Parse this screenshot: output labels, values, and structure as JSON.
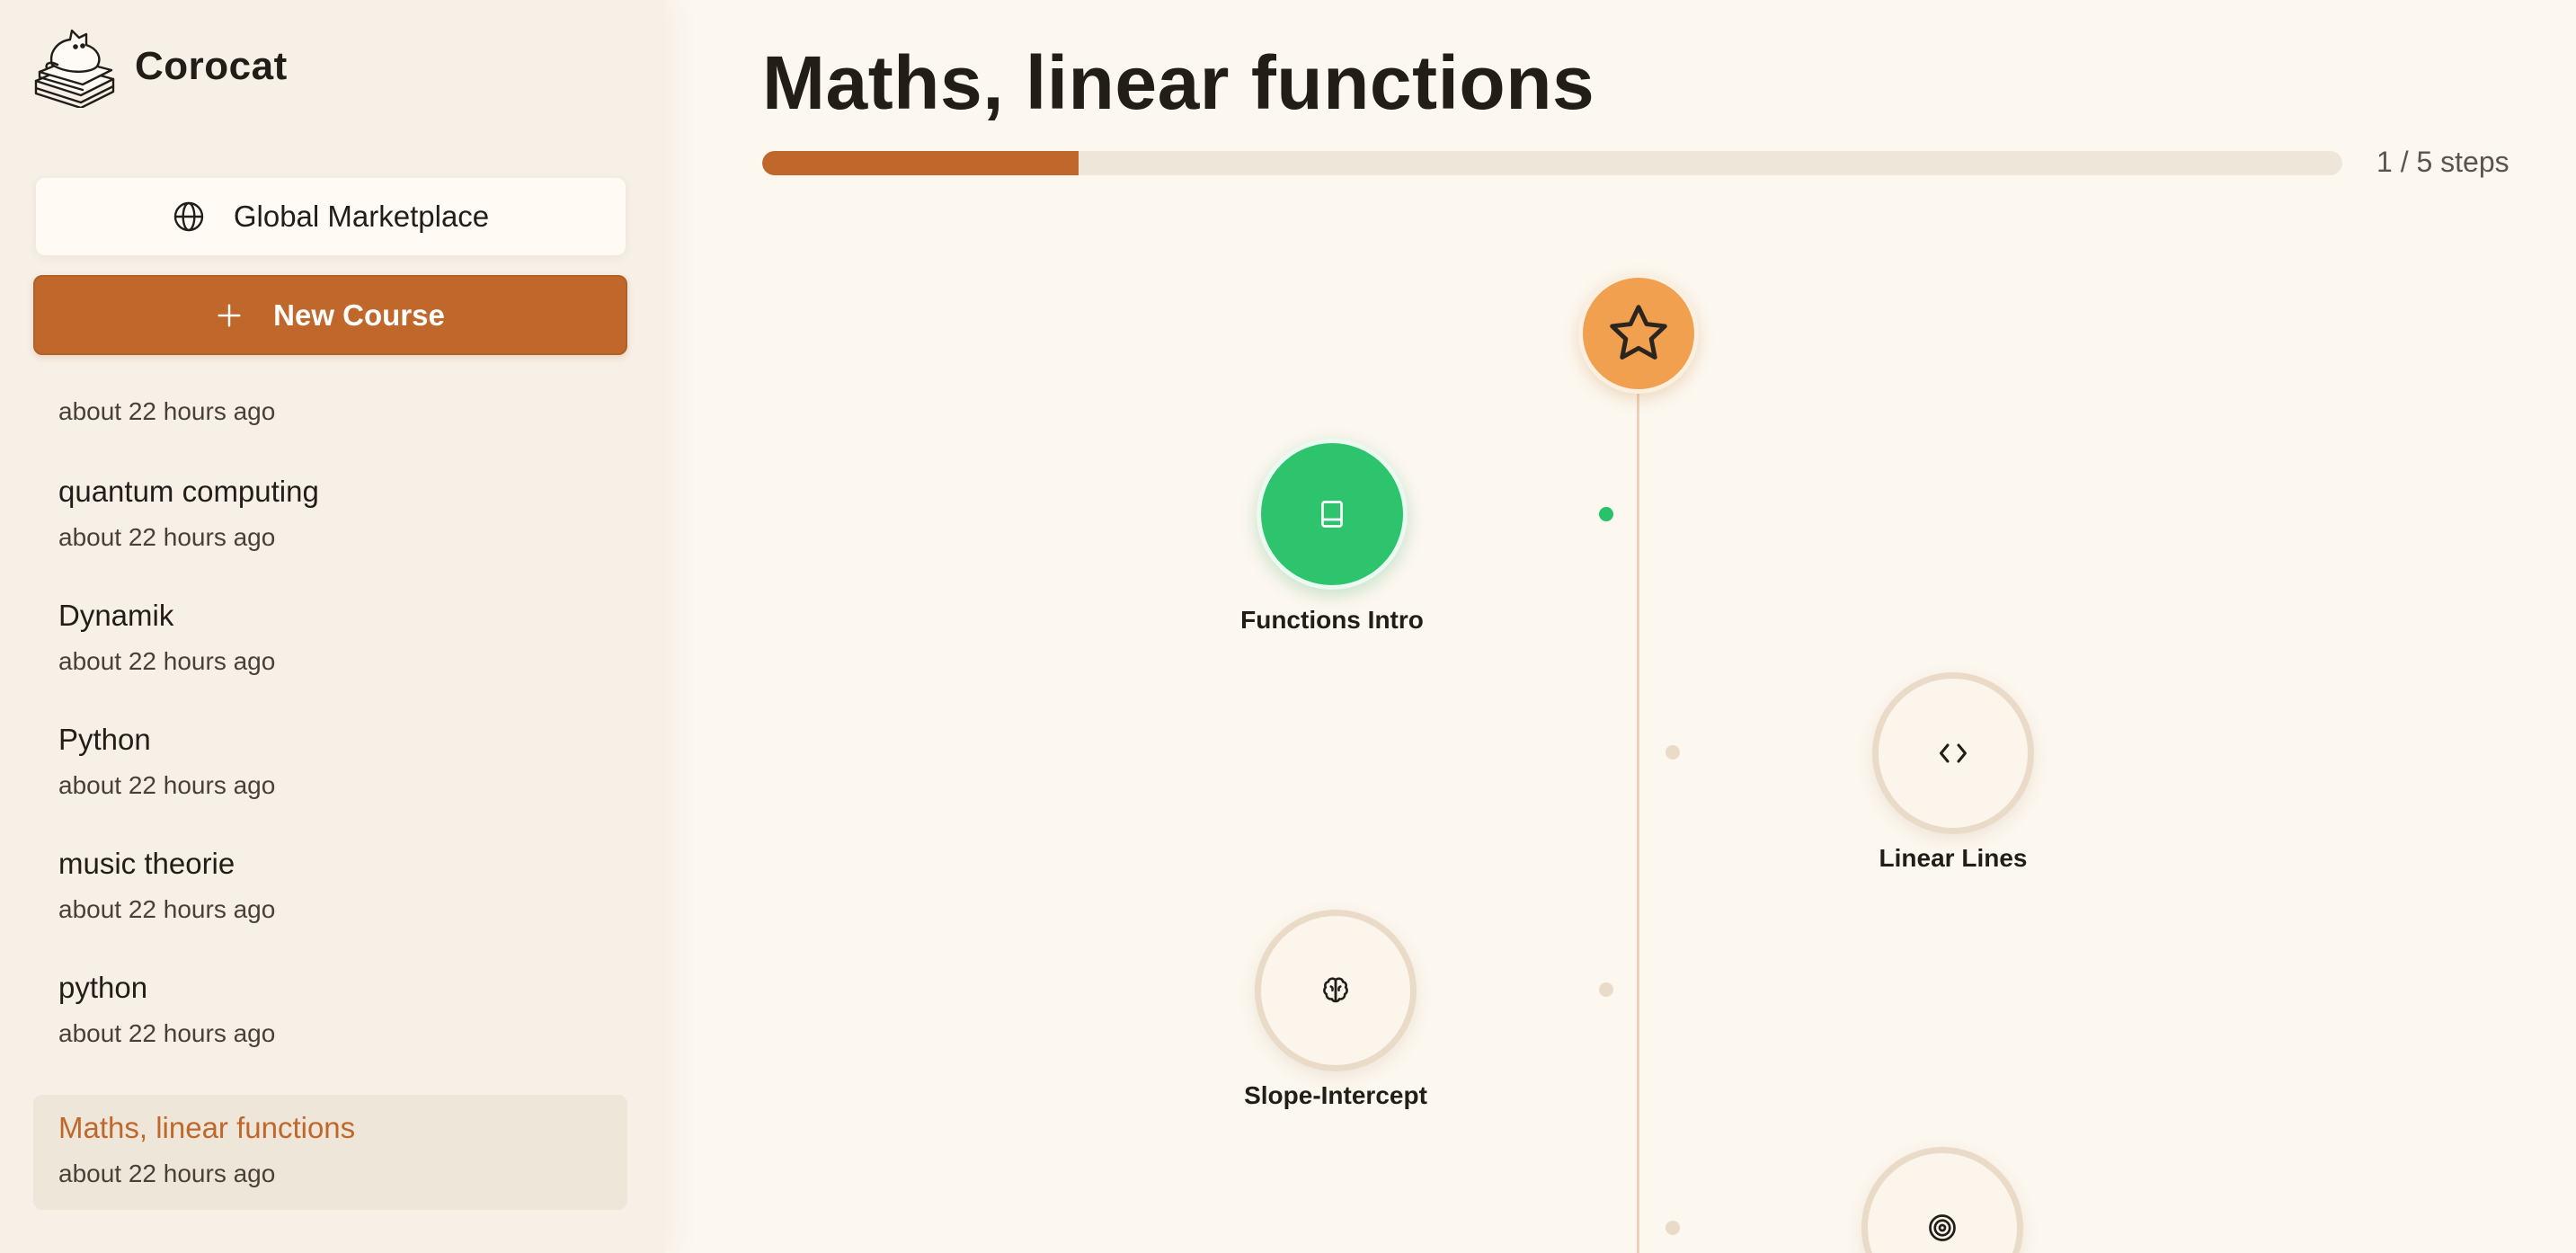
{
  "app": {
    "name": "Corocat"
  },
  "sidebar": {
    "marketplace_label": "Global Marketplace",
    "new_course_label": "New Course",
    "courses": [
      {
        "title": "",
        "time": "about 22 hours ago"
      },
      {
        "title": "quantum computing",
        "time": "about 22 hours ago"
      },
      {
        "title": "Dynamik",
        "time": "about 22 hours ago"
      },
      {
        "title": "Python",
        "time": "about 22 hours ago"
      },
      {
        "title": "music theorie",
        "time": "about 22 hours ago"
      },
      {
        "title": "python",
        "time": "about 22 hours ago"
      },
      {
        "title": "Maths, linear functions",
        "time": "about 22 hours ago",
        "active": true
      }
    ]
  },
  "main": {
    "title": "Maths, linear functions",
    "progress": {
      "current": 1,
      "total": 5,
      "label": "1 / 5 steps",
      "fraction": 0.2
    },
    "steps": [
      {
        "label": "Functions Intro",
        "icon": "book-icon",
        "status": "completed"
      },
      {
        "label": "Linear Lines",
        "icon": "code-icon",
        "status": "locked"
      },
      {
        "label": "Slope-Intercept",
        "icon": "brain-icon",
        "status": "locked"
      },
      {
        "label": "",
        "icon": "target-icon",
        "status": "locked"
      }
    ]
  },
  "colors": {
    "accent": "#c0672c",
    "background": "#fcf7ef",
    "sidebar": "#f7f0e6",
    "completed": "#2ec46e",
    "start_node": "#f0a04f"
  }
}
